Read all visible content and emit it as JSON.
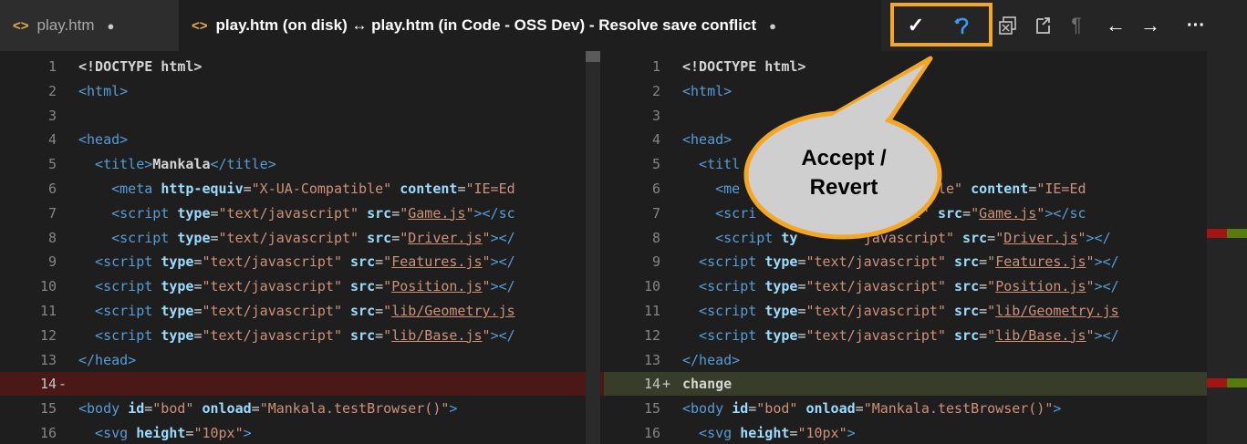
{
  "tabs": [
    {
      "label": "play.htm",
      "icon": "code-file-icon",
      "dirty": "●"
    },
    {
      "label": "play.htm (on disk) ↔ play.htm (in Code - OSS Dev) - Resolve save conflict",
      "icon": "code-file-icon",
      "dirty": "●"
    }
  ],
  "toolbar": {
    "accept_glyph": "✓",
    "revert_glyph": "⟲",
    "pilcrow": "¶",
    "prev_glyph": "←",
    "next_glyph": "→",
    "more_glyph": "···"
  },
  "callout": {
    "line1": "Accept /",
    "line2": "Revert"
  },
  "colors": {
    "highlight": "#f5a623",
    "callout_fill": "#cfcfcf",
    "callout_border": "#f5a623",
    "deleted_bg": "#4b1818",
    "inserted_bg": "#373d29"
  },
  "editors": {
    "left": {
      "lines": [
        {
          "n": "1",
          "mark": "",
          "cls": "",
          "tokens": [
            {
              "t": "<!DOCTYPE html>",
              "c": "t-head"
            }
          ]
        },
        {
          "n": "2",
          "mark": "",
          "cls": "",
          "tokens": [
            {
              "t": "<html>",
              "c": "t-tag"
            }
          ]
        },
        {
          "n": "3",
          "mark": "",
          "cls": "",
          "tokens": []
        },
        {
          "n": "4",
          "mark": "",
          "cls": "",
          "tokens": [
            {
              "t": "<head>",
              "c": "t-tag"
            }
          ]
        },
        {
          "n": "5",
          "mark": "",
          "cls": "",
          "tokens": [
            {
              "t": "  <title>",
              "c": "t-tag"
            },
            {
              "t": "Mankala",
              "c": "t-head"
            },
            {
              "t": "</title>",
              "c": "t-tag"
            }
          ]
        },
        {
          "n": "6",
          "mark": "",
          "cls": "",
          "tokens": [
            {
              "t": "    <meta ",
              "c": "t-tag"
            },
            {
              "t": "http-equiv",
              "c": "t-attr"
            },
            {
              "t": "=",
              "c": "t-text"
            },
            {
              "t": "\"X-UA-Compatible\"",
              "c": "t-str"
            },
            {
              "t": " content",
              "c": "t-attr"
            },
            {
              "t": "=",
              "c": "t-text"
            },
            {
              "t": "\"IE=Ed",
              "c": "t-str"
            }
          ]
        },
        {
          "n": "7",
          "mark": "",
          "cls": "",
          "tokens": [
            {
              "t": "    <script ",
              "c": "t-tag"
            },
            {
              "t": "type",
              "c": "t-attr"
            },
            {
              "t": "=",
              "c": "t-text"
            },
            {
              "t": "\"text/javascript\"",
              "c": "t-str"
            },
            {
              "t": " src",
              "c": "t-attr"
            },
            {
              "t": "=",
              "c": "t-text"
            },
            {
              "t": "\"",
              "c": "t-str"
            },
            {
              "t": "Game.js",
              "c": "t-link"
            },
            {
              "t": "\"",
              "c": "t-str"
            },
            {
              "t": "></sc",
              "c": "t-tag"
            }
          ]
        },
        {
          "n": "8",
          "mark": "",
          "cls": "",
          "tokens": [
            {
              "t": "    <script ",
              "c": "t-tag"
            },
            {
              "t": "type",
              "c": "t-attr"
            },
            {
              "t": "=",
              "c": "t-text"
            },
            {
              "t": "\"text/javascript\"",
              "c": "t-str"
            },
            {
              "t": " src",
              "c": "t-attr"
            },
            {
              "t": "=",
              "c": "t-text"
            },
            {
              "t": "\"",
              "c": "t-str"
            },
            {
              "t": "Driver.js",
              "c": "t-link"
            },
            {
              "t": "\"",
              "c": "t-str"
            },
            {
              "t": "></",
              "c": "t-tag"
            }
          ]
        },
        {
          "n": "9",
          "mark": "",
          "cls": "",
          "tokens": [
            {
              "t": "  <script ",
              "c": "t-tag"
            },
            {
              "t": "type",
              "c": "t-attr"
            },
            {
              "t": "=",
              "c": "t-text"
            },
            {
              "t": "\"text/javascript\"",
              "c": "t-str"
            },
            {
              "t": " src",
              "c": "t-attr"
            },
            {
              "t": "=",
              "c": "t-text"
            },
            {
              "t": "\"",
              "c": "t-str"
            },
            {
              "t": "Features.js",
              "c": "t-link"
            },
            {
              "t": "\"",
              "c": "t-str"
            },
            {
              "t": "></",
              "c": "t-tag"
            }
          ]
        },
        {
          "n": "10",
          "mark": "",
          "cls": "",
          "tokens": [
            {
              "t": "  <script ",
              "c": "t-tag"
            },
            {
              "t": "type",
              "c": "t-attr"
            },
            {
              "t": "=",
              "c": "t-text"
            },
            {
              "t": "\"text/javascript\"",
              "c": "t-str"
            },
            {
              "t": " src",
              "c": "t-attr"
            },
            {
              "t": "=",
              "c": "t-text"
            },
            {
              "t": "\"",
              "c": "t-str"
            },
            {
              "t": "Position.js",
              "c": "t-link"
            },
            {
              "t": "\"",
              "c": "t-str"
            },
            {
              "t": "></",
              "c": "t-tag"
            }
          ]
        },
        {
          "n": "11",
          "mark": "",
          "cls": "",
          "tokens": [
            {
              "t": "  <script ",
              "c": "t-tag"
            },
            {
              "t": "type",
              "c": "t-attr"
            },
            {
              "t": "=",
              "c": "t-text"
            },
            {
              "t": "\"text/javascript\"",
              "c": "t-str"
            },
            {
              "t": " src",
              "c": "t-attr"
            },
            {
              "t": "=",
              "c": "t-text"
            },
            {
              "t": "\"",
              "c": "t-str"
            },
            {
              "t": "lib/Geometry.js",
              "c": "t-link"
            }
          ]
        },
        {
          "n": "12",
          "mark": "",
          "cls": "",
          "tokens": [
            {
              "t": "  <script ",
              "c": "t-tag"
            },
            {
              "t": "type",
              "c": "t-attr"
            },
            {
              "t": "=",
              "c": "t-text"
            },
            {
              "t": "\"text/javascript\"",
              "c": "t-str"
            },
            {
              "t": " src",
              "c": "t-attr"
            },
            {
              "t": "=",
              "c": "t-text"
            },
            {
              "t": "\"",
              "c": "t-str"
            },
            {
              "t": "lib/Base.js",
              "c": "t-link"
            },
            {
              "t": "\"",
              "c": "t-str"
            },
            {
              "t": "></",
              "c": "t-tag"
            }
          ]
        },
        {
          "n": "13",
          "mark": "",
          "cls": "",
          "tokens": [
            {
              "t": "</head>",
              "c": "t-tag"
            }
          ]
        },
        {
          "n": "14",
          "mark": "-",
          "cls": "del",
          "tokens": []
        },
        {
          "n": "15",
          "mark": "",
          "cls": "",
          "tokens": [
            {
              "t": "<body ",
              "c": "t-tag"
            },
            {
              "t": "id",
              "c": "t-attr"
            },
            {
              "t": "=",
              "c": "t-text"
            },
            {
              "t": "\"bod\"",
              "c": "t-str"
            },
            {
              "t": " onload",
              "c": "t-attr"
            },
            {
              "t": "=",
              "c": "t-text"
            },
            {
              "t": "\"Mankala.testBrowser()\"",
              "c": "t-str"
            },
            {
              "t": ">",
              "c": "t-tag"
            }
          ]
        },
        {
          "n": "16",
          "mark": "",
          "cls": "",
          "tokens": [
            {
              "t": "  <svg ",
              "c": "t-tag"
            },
            {
              "t": "height",
              "c": "t-attr"
            },
            {
              "t": "=",
              "c": "t-text"
            },
            {
              "t": "\"10px\"",
              "c": "t-str"
            },
            {
              "t": ">",
              "c": "t-tag"
            }
          ]
        }
      ]
    },
    "right": {
      "lines": [
        {
          "n": "1",
          "mark": "",
          "cls": "",
          "tokens": [
            {
              "t": "<!DOCTYPE html>",
              "c": "t-head"
            }
          ]
        },
        {
          "n": "2",
          "mark": "",
          "cls": "",
          "tokens": [
            {
              "t": "<html>",
              "c": "t-tag"
            }
          ]
        },
        {
          "n": "3",
          "mark": "",
          "cls": "",
          "tokens": []
        },
        {
          "n": "4",
          "mark": "",
          "cls": "",
          "tokens": [
            {
              "t": "<head>",
              "c": "t-tag"
            }
          ]
        },
        {
          "n": "5",
          "mark": "",
          "cls": "",
          "tokens": [
            {
              "t": "  <titl",
              "c": "t-tag"
            }
          ]
        },
        {
          "n": "6",
          "mark": "",
          "cls": "",
          "tokens": [
            {
              "t": "    <me",
              "c": "t-tag"
            },
            {
              "t": "                ",
              "c": "t-text"
            },
            {
              "t": "Compatible\"",
              "c": "t-str"
            },
            {
              "t": " content",
              "c": "t-attr"
            },
            {
              "t": "=",
              "c": "t-text"
            },
            {
              "t": "\"IE=Ed",
              "c": "t-str"
            }
          ]
        },
        {
          "n": "7",
          "mark": "",
          "cls": "",
          "tokens": [
            {
              "t": "    <scri",
              "c": "t-tag"
            },
            {
              "t": "             ",
              "c": "t-text"
            },
            {
              "t": "ascript\"",
              "c": "t-str"
            },
            {
              "t": " src",
              "c": "t-attr"
            },
            {
              "t": "=",
              "c": "t-text"
            },
            {
              "t": "\"",
              "c": "t-str"
            },
            {
              "t": "Game.js",
              "c": "t-link"
            },
            {
              "t": "\"",
              "c": "t-str"
            },
            {
              "t": "></sc",
              "c": "t-tag"
            }
          ]
        },
        {
          "n": "8",
          "mark": "",
          "cls": "",
          "tokens": [
            {
              "t": "    <script ",
              "c": "t-tag"
            },
            {
              "t": "ty",
              "c": "t-attr"
            },
            {
              "t": "        ",
              "c": "t-text"
            },
            {
              "t": "javascript\"",
              "c": "t-str"
            },
            {
              "t": " src",
              "c": "t-attr"
            },
            {
              "t": "=",
              "c": "t-text"
            },
            {
              "t": "\"",
              "c": "t-str"
            },
            {
              "t": "Driver.js",
              "c": "t-link"
            },
            {
              "t": "\"",
              "c": "t-str"
            },
            {
              "t": "></",
              "c": "t-tag"
            }
          ]
        },
        {
          "n": "9",
          "mark": "",
          "cls": "",
          "tokens": [
            {
              "t": "  <script ",
              "c": "t-tag"
            },
            {
              "t": "type",
              "c": "t-attr"
            },
            {
              "t": "=",
              "c": "t-text"
            },
            {
              "t": "\"text/javascript\"",
              "c": "t-str"
            },
            {
              "t": " src",
              "c": "t-attr"
            },
            {
              "t": "=",
              "c": "t-text"
            },
            {
              "t": "\"",
              "c": "t-str"
            },
            {
              "t": "Features.js",
              "c": "t-link"
            },
            {
              "t": "\"",
              "c": "t-str"
            },
            {
              "t": "></",
              "c": "t-tag"
            }
          ]
        },
        {
          "n": "10",
          "mark": "",
          "cls": "",
          "tokens": [
            {
              "t": "  <script ",
              "c": "t-tag"
            },
            {
              "t": "type",
              "c": "t-attr"
            },
            {
              "t": "=",
              "c": "t-text"
            },
            {
              "t": "\"text/javascript\"",
              "c": "t-str"
            },
            {
              "t": " src",
              "c": "t-attr"
            },
            {
              "t": "=",
              "c": "t-text"
            },
            {
              "t": "\"",
              "c": "t-str"
            },
            {
              "t": "Position.js",
              "c": "t-link"
            },
            {
              "t": "\"",
              "c": "t-str"
            },
            {
              "t": "></",
              "c": "t-tag"
            }
          ]
        },
        {
          "n": "11",
          "mark": "",
          "cls": "",
          "tokens": [
            {
              "t": "  <script ",
              "c": "t-tag"
            },
            {
              "t": "type",
              "c": "t-attr"
            },
            {
              "t": "=",
              "c": "t-text"
            },
            {
              "t": "\"text/javascript\"",
              "c": "t-str"
            },
            {
              "t": " src",
              "c": "t-attr"
            },
            {
              "t": "=",
              "c": "t-text"
            },
            {
              "t": "\"",
              "c": "t-str"
            },
            {
              "t": "lib/Geometry.js",
              "c": "t-link"
            }
          ]
        },
        {
          "n": "12",
          "mark": "",
          "cls": "",
          "tokens": [
            {
              "t": "  <script ",
              "c": "t-tag"
            },
            {
              "t": "type",
              "c": "t-attr"
            },
            {
              "t": "=",
              "c": "t-text"
            },
            {
              "t": "\"text/javascript\"",
              "c": "t-str"
            },
            {
              "t": " src",
              "c": "t-attr"
            },
            {
              "t": "=",
              "c": "t-text"
            },
            {
              "t": "\"",
              "c": "t-str"
            },
            {
              "t": "lib/Base.js",
              "c": "t-link"
            },
            {
              "t": "\"",
              "c": "t-str"
            },
            {
              "t": "></",
              "c": "t-tag"
            }
          ]
        },
        {
          "n": "13",
          "mark": "",
          "cls": "",
          "tokens": [
            {
              "t": "</head>",
              "c": "t-tag"
            }
          ]
        },
        {
          "n": "14",
          "mark": "+",
          "cls": "ins",
          "tokens": [
            {
              "t": "change",
              "c": "t-head"
            }
          ]
        },
        {
          "n": "15",
          "mark": "",
          "cls": "",
          "tokens": [
            {
              "t": "<body ",
              "c": "t-tag"
            },
            {
              "t": "id",
              "c": "t-attr"
            },
            {
              "t": "=",
              "c": "t-text"
            },
            {
              "t": "\"bod\"",
              "c": "t-str"
            },
            {
              "t": " onload",
              "c": "t-attr"
            },
            {
              "t": "=",
              "c": "t-text"
            },
            {
              "t": "\"Mankala.testBrowser()\"",
              "c": "t-str"
            },
            {
              "t": ">",
              "c": "t-tag"
            }
          ]
        },
        {
          "n": "16",
          "mark": "",
          "cls": "",
          "tokens": [
            {
              "t": "  <svg ",
              "c": "t-tag"
            },
            {
              "t": "height",
              "c": "t-attr"
            },
            {
              "t": "=",
              "c": "t-text"
            },
            {
              "t": "\"10px\"",
              "c": "t-str"
            },
            {
              "t": ">",
              "c": "t-tag"
            }
          ]
        }
      ]
    }
  }
}
